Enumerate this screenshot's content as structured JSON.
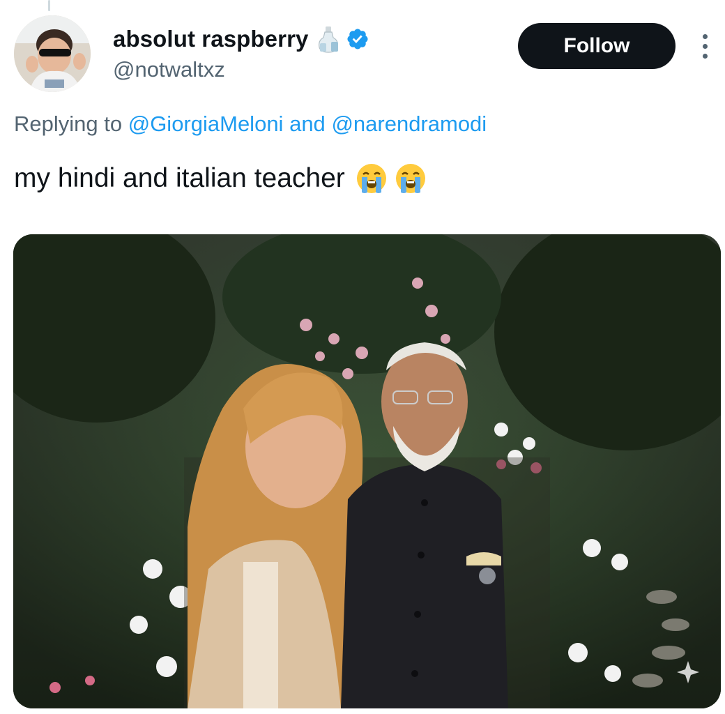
{
  "tweet": {
    "author": {
      "display_name": "absolut raspberry",
      "handle": "@notwaltxz",
      "verified": true,
      "name_emoji": "bottle-icon"
    },
    "follow_label": "Follow",
    "reply_prefix": "Replying to",
    "reply_mentions": [
      "@GiorgiaMeloni",
      "@narendramodi"
    ],
    "reply_conjunction": "and",
    "text": "my hindi and italian teacher",
    "text_emojis": [
      "loudly-crying-face-icon",
      "loudly-crying-face-icon"
    ],
    "colors": {
      "text": "#0f1419",
      "secondary": "#536471",
      "link": "#1d9bf0",
      "follow_bg": "#0f1419",
      "follow_fg": "#ffffff",
      "verified": "#1d9bf0"
    }
  }
}
